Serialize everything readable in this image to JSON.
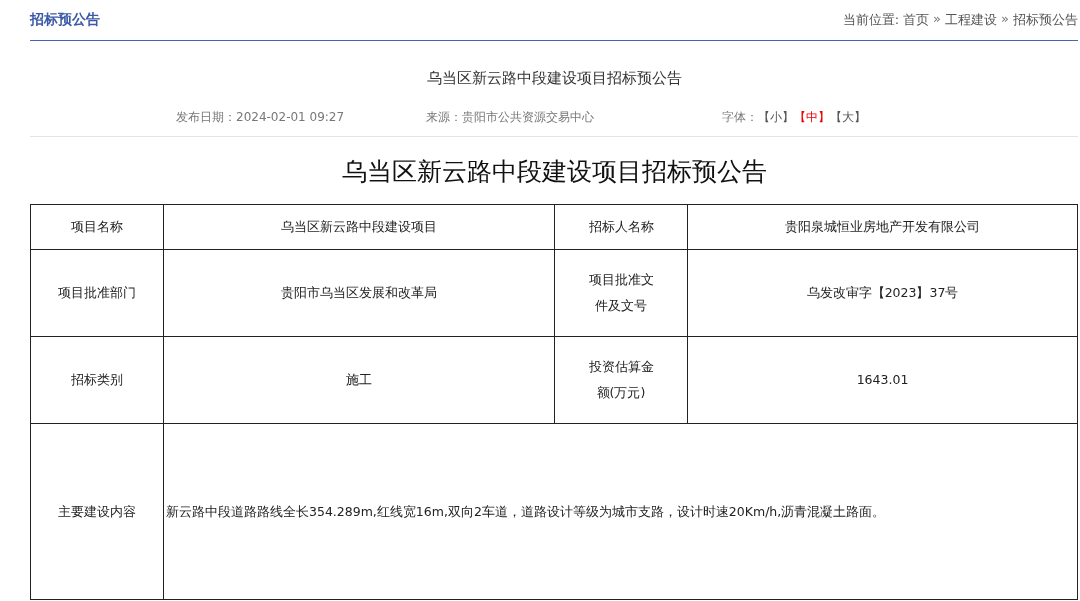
{
  "header": {
    "section_title": "招标预公告",
    "breadcrumb": {
      "label": "当前位置:",
      "items": [
        {
          "kind": "link",
          "text": "首页"
        },
        {
          "kind": "sep",
          "text": "»"
        },
        {
          "kind": "link",
          "text": "工程建设"
        },
        {
          "kind": "sep",
          "text": "»"
        },
        {
          "kind": "link",
          "text": "招标预公告"
        }
      ]
    }
  },
  "article": {
    "title": "乌当区新云路中段建设项目招标预公告",
    "publish_date": "发布日期：2024-02-01 09:27",
    "source": "来源：贵阳市公共资源交易中心",
    "font_size": {
      "label": "字体：",
      "options": [
        {
          "text": "【小】",
          "selected": false
        },
        {
          "text": "【中】",
          "selected": true
        },
        {
          "text": "【大】",
          "selected": false
        }
      ]
    },
    "heading": "乌当区新云路中段建设项目招标预公告",
    "table": {
      "rows": [
        {
          "cells": [
            {
              "kind": "label",
              "text": "项目名称"
            },
            {
              "kind": "value",
              "text": "乌当区新云路中段建设项目"
            },
            {
              "kind": "label",
              "text": "招标人名称"
            },
            {
              "kind": "value",
              "text": "贵阳泉城恒业房地产开发有限公司"
            }
          ]
        },
        {
          "cells": [
            {
              "kind": "label",
              "text": "项目批准部门"
            },
            {
              "kind": "value",
              "text": "贵阳市乌当区发展和改革局"
            },
            {
              "kind": "label",
              "text": "项目批准文件及文号"
            },
            {
              "kind": "value",
              "text": "乌发改审字【2023】37号"
            }
          ]
        },
        {
          "cells": [
            {
              "kind": "label",
              "text": "招标类别"
            },
            {
              "kind": "value",
              "text": "施工"
            },
            {
              "kind": "label",
              "text": "投资估算金额(万元)"
            },
            {
              "kind": "value",
              "text": "1643.01"
            }
          ]
        },
        {
          "cells": [
            {
              "kind": "label",
              "text": "主要建设内容"
            },
            {
              "kind": "wide",
              "colspan": 3,
              "text": "新云路中段道路路线全长354.289m,红线宽16m,双向2车道，道路设计等级为城市支路，设计时速20Km/h,沥青混凝土路面。"
            }
          ]
        }
      ]
    }
  }
}
